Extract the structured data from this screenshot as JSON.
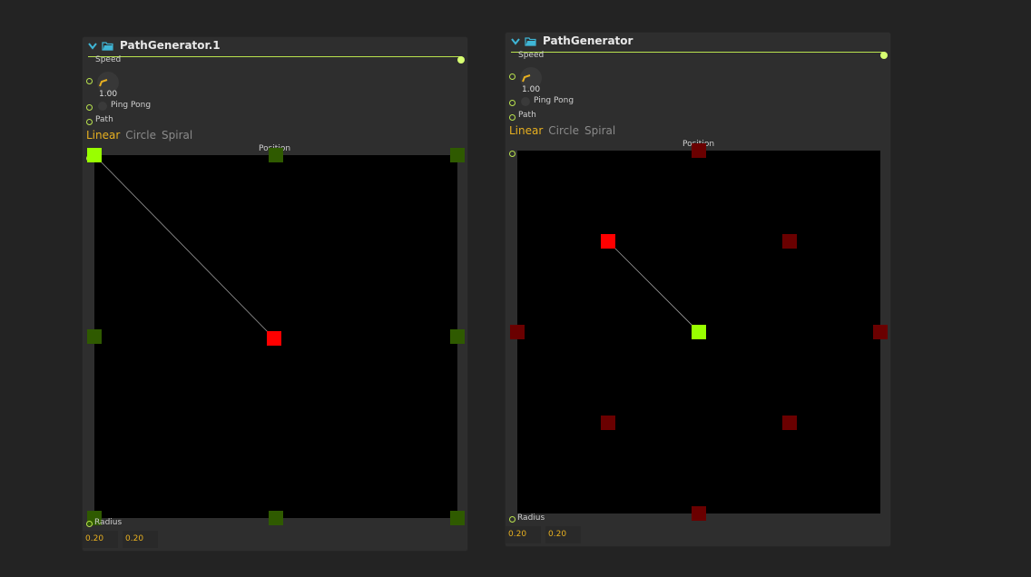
{
  "nodes": [
    {
      "title": "PathGenerator.1",
      "speed_label": "Speed",
      "speed_value": "1.00",
      "pingpong_label": "Ping Pong",
      "path_label": "Path",
      "tabs": [
        "Linear",
        "Circle",
        "Spiral"
      ],
      "active_tab": "Linear",
      "position_label": "Position",
      "radius_label": "Radius",
      "radius_values": [
        "0.20",
        "0.20"
      ],
      "colors": {
        "handle_current": "#99ff00",
        "handle": "#2f5a00",
        "target": "#ff0000"
      },
      "handles": [
        [
          0,
          0
        ],
        [
          0.5,
          0
        ],
        [
          1,
          0
        ],
        [
          0,
          0.5
        ],
        [
          1,
          0.5
        ],
        [
          0,
          1
        ],
        [
          0.5,
          1
        ],
        [
          1,
          1
        ]
      ],
      "current": [
        0,
        0
      ],
      "target": [
        0.495,
        0.505
      ]
    },
    {
      "title": "PathGenerator",
      "speed_label": "Speed",
      "speed_value": "1.00",
      "pingpong_label": "Ping Pong",
      "path_label": "Path",
      "tabs": [
        "Linear",
        "Circle",
        "Spiral"
      ],
      "active_tab": "Linear",
      "position_label": "Position",
      "radius_label": "Radius",
      "radius_values": [
        "0.20",
        "0.20"
      ],
      "colors": {
        "handle_current": "#99ff00",
        "handle": "#6a0000",
        "target": "#ff0000"
      },
      "handles": [
        [
          0.5,
          0
        ],
        [
          0,
          0.5
        ],
        [
          1,
          0.5
        ],
        [
          0.5,
          1
        ],
        [
          0.75,
          0.25
        ],
        [
          0.25,
          0.75
        ],
        [
          0.75,
          0.75
        ]
      ],
      "current": [
        0.5,
        0.5
      ],
      "target": [
        0.25,
        0.25
      ]
    }
  ]
}
